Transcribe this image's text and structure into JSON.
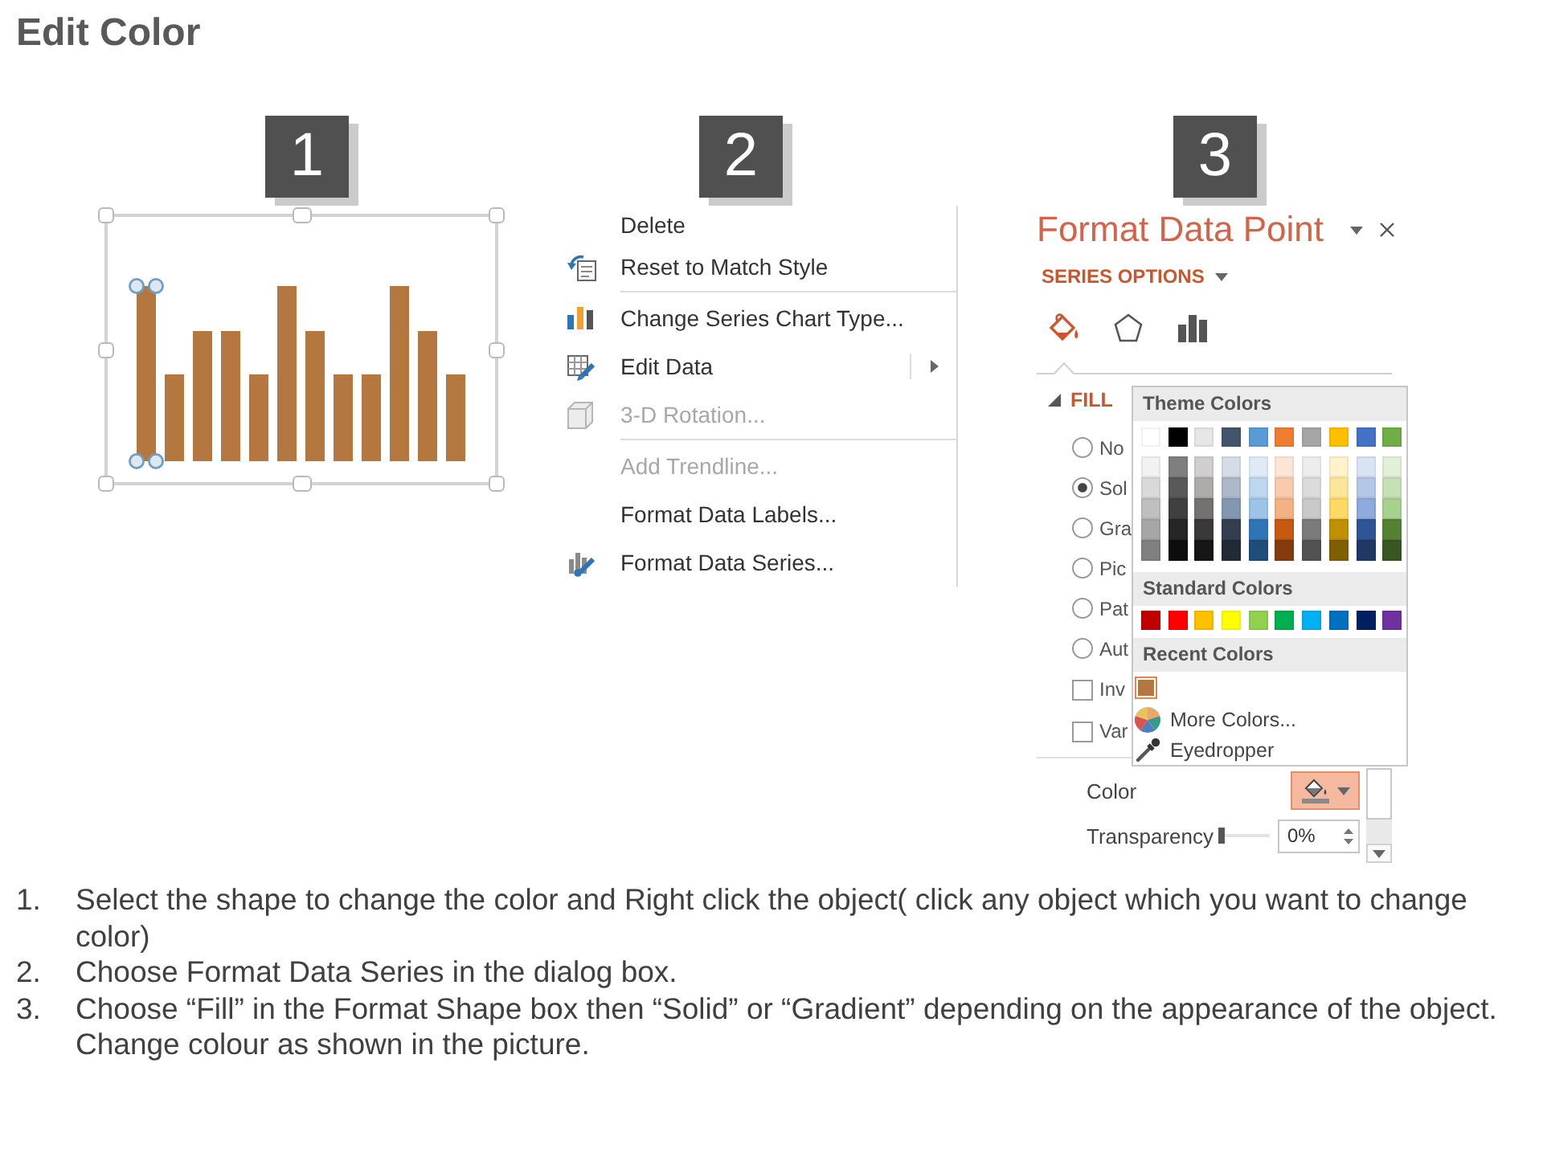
{
  "title": "Edit Color",
  "chart_panel": {
    "badge": "1",
    "chart": {
      "selected": true,
      "bars": [
        {
          "selected": true
        },
        {
          "selected": false
        },
        {
          "selected": false
        },
        {
          "selected": false
        },
        {
          "selected": false
        },
        {
          "selected": false
        },
        {
          "selected": false
        },
        {
          "selected": false
        },
        {
          "selected": false
        },
        {
          "selected": false
        },
        {
          "selected": false
        },
        {
          "selected": false
        }
      ]
    }
  },
  "context_menu_panel": {
    "badge": "2",
    "groups": [
      [
        {
          "kind": "plain",
          "label": "Delete",
          "disabled": false,
          "submenu": false
        },
        {
          "kind": "reset",
          "label": "Reset to Match Style",
          "disabled": false,
          "submenu": false
        }
      ],
      [
        {
          "kind": "charttype",
          "label": "Change Series Chart Type...",
          "disabled": false,
          "submenu": false
        },
        {
          "kind": "editdata",
          "label": "Edit Data",
          "disabled": false,
          "submenu": true
        },
        {
          "kind": "rotation",
          "label": "3-D Rotation...",
          "disabled": true,
          "submenu": false
        }
      ],
      [
        {
          "kind": "plain",
          "label": "Add Trendline...",
          "disabled": true,
          "submenu": false
        },
        {
          "kind": "plain",
          "label": "Format Data Labels...",
          "disabled": false,
          "submenu": false
        },
        {
          "kind": "series",
          "label": "Format Data Series...",
          "disabled": false,
          "submenu": false
        }
      ]
    ]
  },
  "format_pane_panel": {
    "badge": "3",
    "pane": {
      "title": "Format Data Point",
      "options_menu": "SERIES OPTIONS",
      "tabs": [
        {
          "kind": "fill",
          "selected": true
        },
        {
          "kind": "shape",
          "selected": false
        },
        {
          "kind": "options",
          "selected": false
        }
      ],
      "fill_section": {
        "label": "FILL",
        "expanded": true,
        "fill_options": [
          {
            "label": "No",
            "selected": false
          },
          {
            "label": "Sol",
            "selected": true
          },
          {
            "label": "Gra",
            "selected": false
          },
          {
            "label": "Pic",
            "selected": false
          },
          {
            "label": "Pat",
            "selected": false
          },
          {
            "label": "Aut",
            "selected": false
          }
        ],
        "checkboxes": [
          {
            "label": "Inv",
            "checked": false
          },
          {
            "label": "Var",
            "checked": false
          }
        ],
        "color": {
          "label": "Color",
          "expanded": true,
          "menu": {
            "theme_colors": {
              "title": "Theme Colors",
              "rows": [
                [
                  {
                    "color": "#ffffff",
                    "selected": false
                  },
                  {
                    "color": "#000000",
                    "selected": false
                  },
                  {
                    "color": "#e7e6e6",
                    "selected": false
                  },
                  {
                    "color": "#44546a",
                    "selected": false
                  },
                  {
                    "color": "#5b9bd5",
                    "selected": false
                  },
                  {
                    "color": "#ed7d31",
                    "selected": false
                  },
                  {
                    "color": "#a5a5a5",
                    "selected": false
                  },
                  {
                    "color": "#ffc000",
                    "selected": false
                  },
                  {
                    "color": "#4472c4",
                    "selected": false
                  },
                  {
                    "color": "#70ad47",
                    "selected": false
                  }
                ],
                [
                  {
                    "color": "#f2f2f2",
                    "selected": false
                  },
                  {
                    "color": "#7f7f7f",
                    "selected": false
                  },
                  {
                    "color": "#d0cece",
                    "selected": false
                  },
                  {
                    "color": "#d6dce5",
                    "selected": false
                  },
                  {
                    "color": "#deebf7",
                    "selected": false
                  },
                  {
                    "color": "#fbe5d6",
                    "selected": false
                  },
                  {
                    "color": "#ededed",
                    "selected": false
                  },
                  {
                    "color": "#fff2cc",
                    "selected": false
                  },
                  {
                    "color": "#dae3f3",
                    "selected": false
                  },
                  {
                    "color": "#e2f0d9",
                    "selected": false
                  }
                ],
                [
                  {
                    "color": "#d9d9d9",
                    "selected": false
                  },
                  {
                    "color": "#595959",
                    "selected": false
                  },
                  {
                    "color": "#aeabab",
                    "selected": false
                  },
                  {
                    "color": "#adb9ca",
                    "selected": false
                  },
                  {
                    "color": "#bdd7ee",
                    "selected": false
                  },
                  {
                    "color": "#f8cbad",
                    "selected": false
                  },
                  {
                    "color": "#dbdbdb",
                    "selected": false
                  },
                  {
                    "color": "#ffe699",
                    "selected": false
                  },
                  {
                    "color": "#b4c7e7",
                    "selected": false
                  },
                  {
                    "color": "#c5e0b4",
                    "selected": false
                  }
                ],
                [
                  {
                    "color": "#bfbfbf",
                    "selected": false
                  },
                  {
                    "color": "#404040",
                    "selected": false
                  },
                  {
                    "color": "#757171",
                    "selected": false
                  },
                  {
                    "color": "#8497b0",
                    "selected": false
                  },
                  {
                    "color": "#9dc3e6",
                    "selected": false
                  },
                  {
                    "color": "#f4b183",
                    "selected": false
                  },
                  {
                    "color": "#c9c9c9",
                    "selected": false
                  },
                  {
                    "color": "#ffd966",
                    "selected": false
                  },
                  {
                    "color": "#8faadc",
                    "selected": false
                  },
                  {
                    "color": "#a9d18e",
                    "selected": false
                  }
                ],
                [
                  {
                    "color": "#a6a6a6",
                    "selected": false
                  },
                  {
                    "color": "#262626",
                    "selected": false
                  },
                  {
                    "color": "#3a3838",
                    "selected": false
                  },
                  {
                    "color": "#333f50",
                    "selected": false
                  },
                  {
                    "color": "#2e75b6",
                    "selected": false
                  },
                  {
                    "color": "#c55a11",
                    "selected": false
                  },
                  {
                    "color": "#7b7b7b",
                    "selected": false
                  },
                  {
                    "color": "#bf9000",
                    "selected": false
                  },
                  {
                    "color": "#2f5597",
                    "selected": false
                  },
                  {
                    "color": "#548235",
                    "selected": false
                  }
                ],
                [
                  {
                    "color": "#808080",
                    "selected": false
                  },
                  {
                    "color": "#0d0d0d",
                    "selected": false
                  },
                  {
                    "color": "#171616",
                    "selected": false
                  },
                  {
                    "color": "#222a35",
                    "selected": false
                  },
                  {
                    "color": "#1f4e79",
                    "selected": false
                  },
                  {
                    "color": "#843c0c",
                    "selected": false
                  },
                  {
                    "color": "#525252",
                    "selected": false
                  },
                  {
                    "color": "#7f6000",
                    "selected": false
                  },
                  {
                    "color": "#203864",
                    "selected": false
                  },
                  {
                    "color": "#385723",
                    "selected": false
                  }
                ]
              ]
            },
            "standard_colors": {
              "title": "Standard Colors",
              "swatches": [
                {
                  "color": "#c00000",
                  "selected": false
                },
                {
                  "color": "#ff0000",
                  "selected": false
                },
                {
                  "color": "#ffc000",
                  "selected": false
                },
                {
                  "color": "#ffff00",
                  "selected": false
                },
                {
                  "color": "#92d050",
                  "selected": false
                },
                {
                  "color": "#00b050",
                  "selected": false
                },
                {
                  "color": "#00b0f0",
                  "selected": false
                },
                {
                  "color": "#0070c0",
                  "selected": false
                },
                {
                  "color": "#002060",
                  "selected": false
                },
                {
                  "color": "#7030a0",
                  "selected": false
                }
              ]
            },
            "recent_colors": {
              "title": "Recent Colors",
              "swatches": [
                {
                  "color": "#b4773f",
                  "selected": true
                }
              ]
            },
            "commands": [
              {
                "kind": "wheel",
                "label": "More Colors..."
              },
              {
                "kind": "dropper",
                "label": "Eyedropper"
              }
            ]
          }
        },
        "transparency": {
          "label": "Transparency",
          "level": 0,
          "value": "0%"
        }
      }
    }
  },
  "instructions": [
    {
      "number": "1.",
      "text": "Select the shape to change the color and Right click the object( click any object which you want to change color)"
    },
    {
      "number": "2.",
      "text": "Choose Format Data Series in the dialog box."
    },
    {
      "number": "3.",
      "text": "Choose “Fill” in the Format Shape box then “Solid” or “Gradient” depending on the appearance of the object. Change colour as shown in the picture."
    }
  ]
}
